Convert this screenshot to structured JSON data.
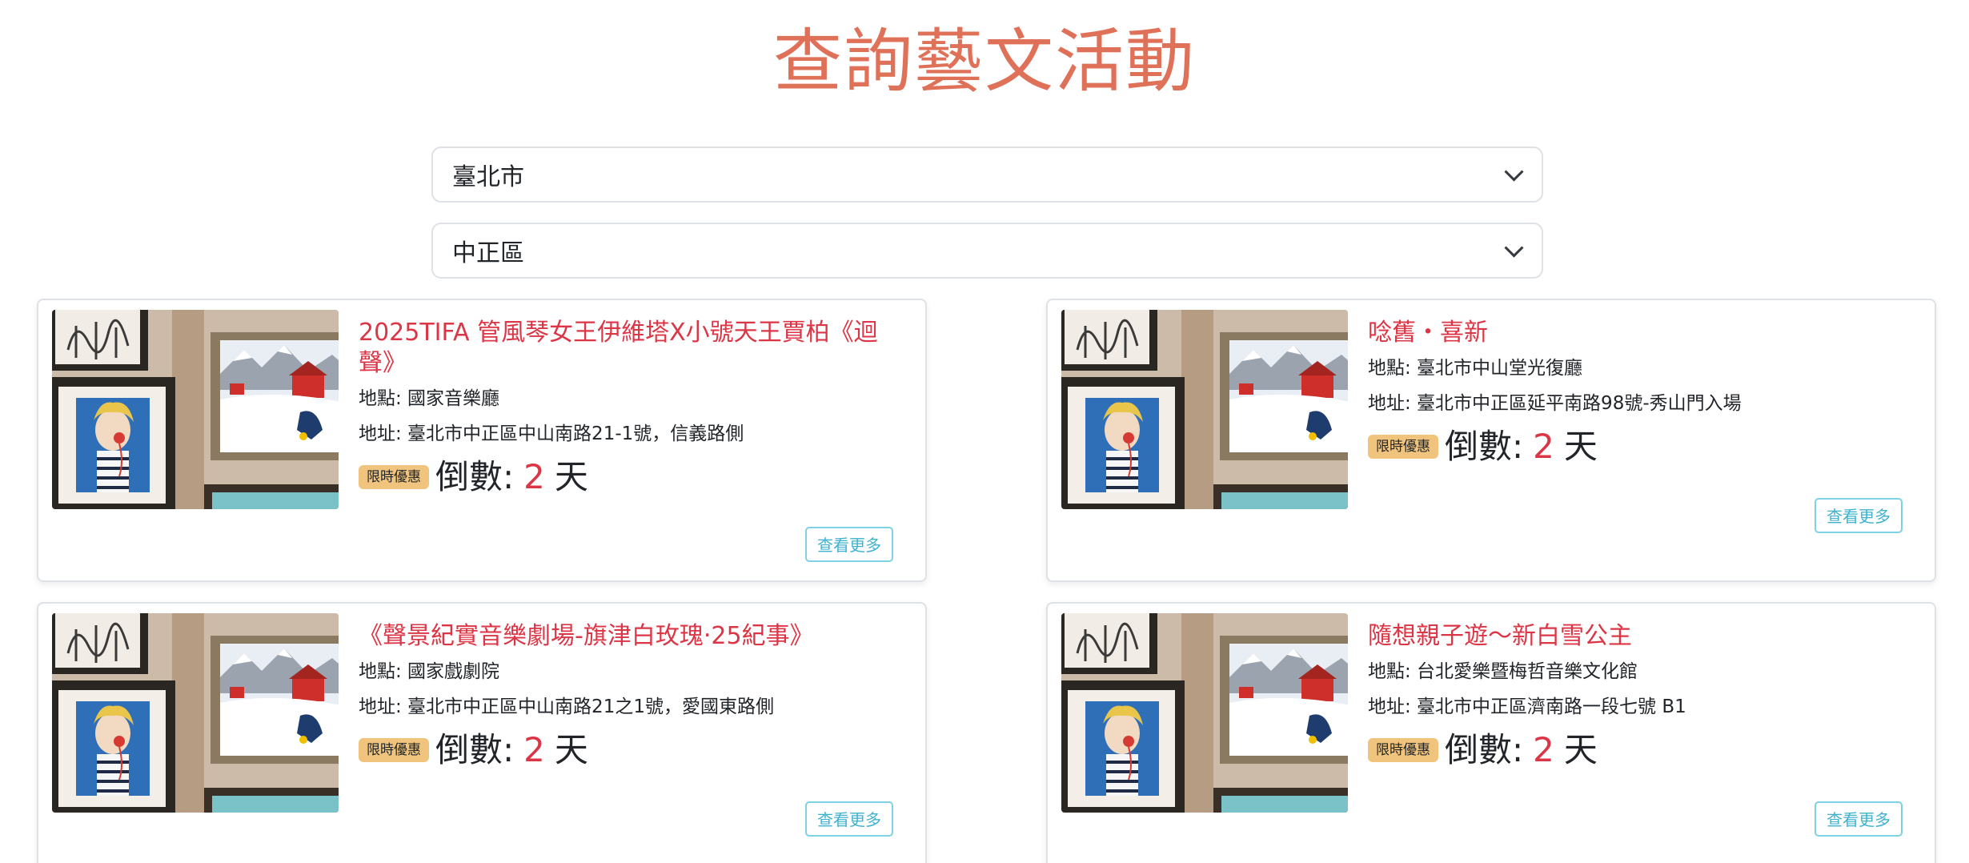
{
  "page": {
    "title": "查詢藝文活動"
  },
  "filters": {
    "city": "臺北市",
    "district": "中正區"
  },
  "colors": {
    "title": "#e07159",
    "event_title": "#dc3545",
    "badge_bg": "#f0c47c",
    "countdown_number": "#dc3545",
    "button_border": "#7fd2e4",
    "button_text": "#3fb2cf"
  },
  "events": [
    {
      "title": "2025TIFA 管風琴女王伊維塔X小號天王賈柏《迴聲》",
      "venue": "地點: 國家音樂廳",
      "address": "地址: 臺北市中正區中山南路21-1號，信義路側",
      "badge": "限時優惠",
      "countdown_label": "倒數:",
      "countdown_value": "2",
      "countdown_unit": "天",
      "more_label": "查看更多"
    },
    {
      "title": "唸舊・喜新",
      "venue": "地點: 臺北市中山堂光復廳",
      "address": "地址: 臺北市中正區延平南路98號-秀山門入場",
      "badge": "限時優惠",
      "countdown_label": "倒數:",
      "countdown_value": "2",
      "countdown_unit": "天",
      "more_label": "查看更多"
    },
    {
      "title": "《聲景紀實音樂劇場-旗津白玫瑰‧25紀事》",
      "venue": "地點: 國家戲劇院",
      "address": "地址: 臺北市中正區中山南路21之1號，愛國東路側",
      "badge": "限時優惠",
      "countdown_label": "倒數:",
      "countdown_value": "2",
      "countdown_unit": "天",
      "more_label": "查看更多"
    },
    {
      "title": "隨想親子遊～新白雪公主",
      "venue": "地點: 台北愛樂暨梅哲音樂文化館",
      "address": "地址: 臺北市中正區濟南路一段七號 B1",
      "badge": "限時優惠",
      "countdown_label": "倒數:",
      "countdown_value": "2",
      "countdown_unit": "天",
      "more_label": "查看更多"
    }
  ]
}
